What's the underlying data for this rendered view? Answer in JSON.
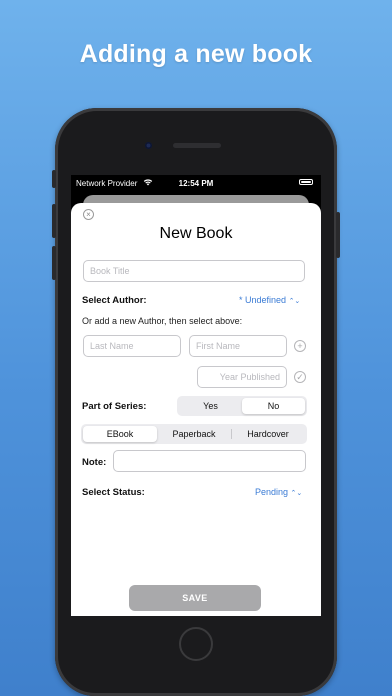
{
  "headline": "Adding a new book",
  "status_bar": {
    "carrier": "Network Provider",
    "time": "12:54 PM"
  },
  "form": {
    "title": "New Book",
    "close_icon": "close-circle-icon",
    "book_title_placeholder": "Book Title",
    "select_author_label": "Select Author:",
    "author_value": "* Undefined",
    "new_author_hint": "Or add a new Author, then select above:",
    "last_name_placeholder": "Last Name",
    "first_name_placeholder": "First Name",
    "year_placeholder": "Year Published",
    "part_of_series_label": "Part of Series:",
    "series_options": [
      "Yes",
      "No"
    ],
    "series_selected": "No",
    "format_options": [
      "EBook",
      "Paperback",
      "Hardcover"
    ],
    "format_selected": "EBook",
    "note_label": "Note:",
    "note_value": "",
    "select_status_label": "Select Status:",
    "status_value": "Pending",
    "save_label": "SAVE"
  },
  "colors": {
    "accent": "#3a7bd5",
    "background_top": "#6fb2ec",
    "background_bottom": "#3f80cc",
    "save_button": "#a9a9ab"
  }
}
